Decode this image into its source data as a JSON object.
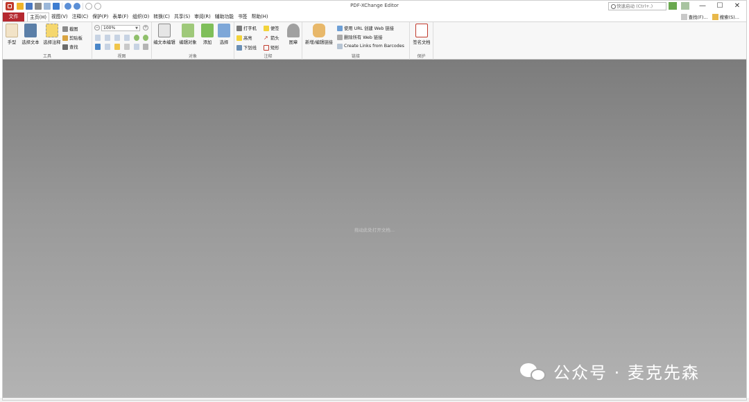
{
  "window": {
    "title": "PDF-XChange Editor",
    "quick_search_placeholder": "快速启动 (Ctrl+.)",
    "controls": {
      "minimize": "—",
      "maximize": "☐",
      "close": "✕"
    }
  },
  "menu": {
    "file": "文件",
    "items": [
      "主页(H)",
      "视图(V)",
      "注释(C)",
      "保护(P)",
      "表单(F)",
      "组织(O)",
      "转换(C)",
      "共享(S)",
      "审阅(R)",
      "辅助功能",
      "书签",
      "帮助(H)"
    ],
    "active_index": 0,
    "right": {
      "find": "查找(F)...",
      "search": "搜索(S)..."
    }
  },
  "ribbon": {
    "tools": {
      "label": "工具",
      "hand": "手型",
      "select_text": "选择文本",
      "select_annotation": "选择注释",
      "snapshot": "截图",
      "clipboard": "剪贴板",
      "find": "查找"
    },
    "view": {
      "label": "视图",
      "zoom": "100%"
    },
    "objects": {
      "label": "对象",
      "edit_text": "编文本编辑",
      "edit_objects": "编辑对象",
      "add": "添加",
      "select": "选择"
    },
    "annotations": {
      "label": "注释",
      "typewriter": "打字机",
      "highlight": "高亮",
      "underline": "下划线",
      "sticky_note": "便签",
      "arrow": "箭头",
      "rectangle": "矩形",
      "stamp": "图章"
    },
    "links": {
      "label": "链接",
      "add_edit_link": "新增/编辑链接",
      "create_web_links": "使用 URL 创建 Web 链接",
      "delete_web_links": "删除所有 Web 链接",
      "barcode_links": "Create Links from Barcodes"
    },
    "protect": {
      "label": "保护",
      "sign": "签名文档"
    }
  },
  "workspace": {
    "hint": "拖动此处打开文档..."
  },
  "watermark": {
    "text": "公众号 · 麦克先森"
  },
  "colors": {
    "file_tab": "#b5282f",
    "workspace_top": "#7c7c7c",
    "workspace_bottom": "#b3b3b3"
  }
}
